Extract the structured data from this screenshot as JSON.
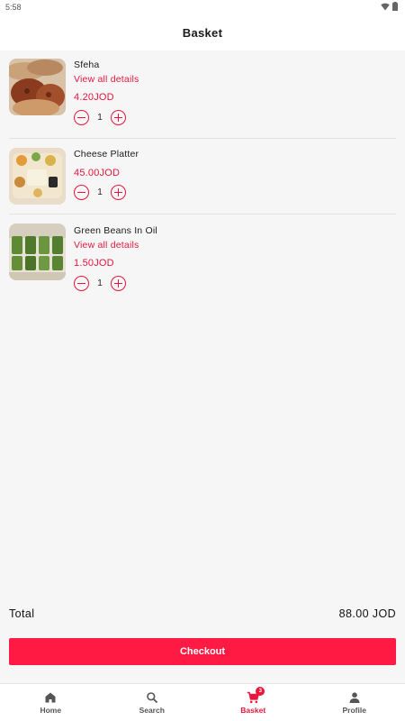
{
  "status_bar": {
    "time": "5:58"
  },
  "header": {
    "title": "Basket"
  },
  "items": [
    {
      "name": "Sfeha",
      "link": "View all details",
      "price": "4.20JOD",
      "qty": "1"
    },
    {
      "name": "Cheese Platter",
      "price": "45.00JOD",
      "qty": "1"
    },
    {
      "name": "Green Beans In Oil",
      "link": "View all details",
      "price": "1.50JOD",
      "qty": "1"
    }
  ],
  "total": {
    "label": "Total",
    "value": "88.00 JOD"
  },
  "checkout": {
    "label": "Checkout"
  },
  "nav": {
    "items": [
      {
        "label": "Home",
        "icon": "home-icon"
      },
      {
        "label": "Search",
        "icon": "search-icon"
      },
      {
        "label": "Basket",
        "icon": "cart-icon",
        "badge": "3"
      },
      {
        "label": "Profile",
        "icon": "person-icon"
      }
    ],
    "active": "Basket"
  },
  "colors": {
    "accent": "#e8153d",
    "button": "#ff1a44",
    "background": "#f6f6f6"
  }
}
